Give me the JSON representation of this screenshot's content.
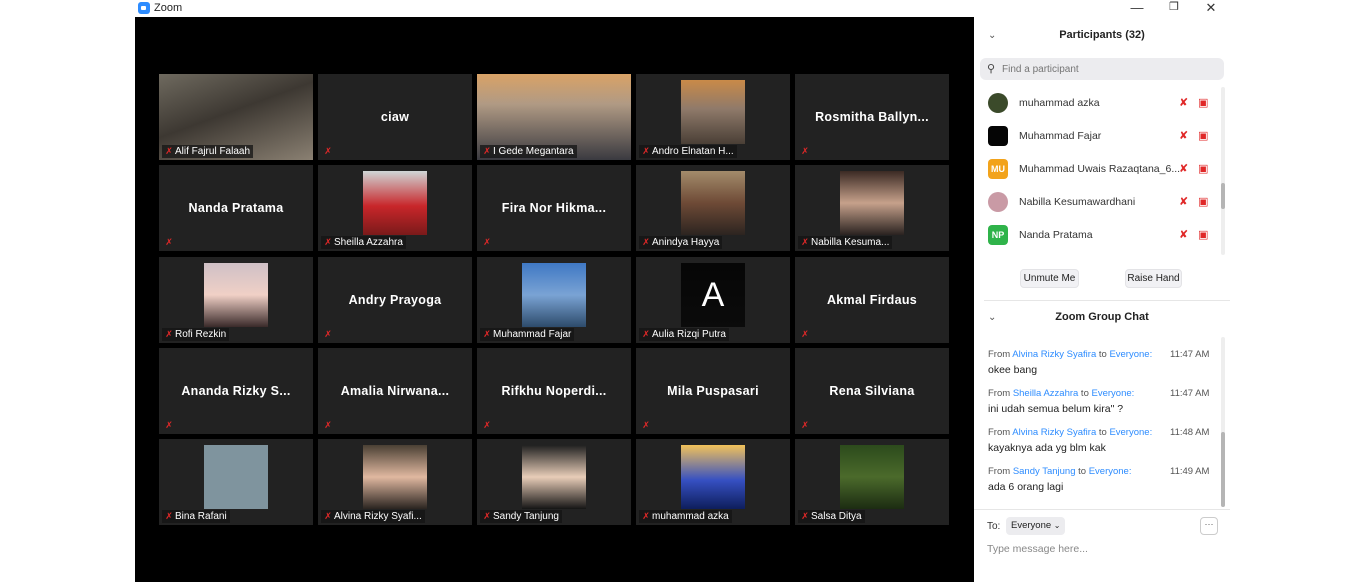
{
  "window": {
    "title": "Zoom",
    "minimize_icon": "minimize-icon",
    "restore_icon": "restore-icon",
    "close_icon": "close-icon"
  },
  "tiles": [
    {
      "name": "Alif Fajrul Falaah",
      "label": "Alif Fajrul Falaah",
      "has_video": true,
      "active": true
    },
    {
      "name": "ciaw",
      "label": "",
      "has_video": false
    },
    {
      "name": "I Gede Megantara",
      "label": "I Gede Megantara",
      "has_video": true
    },
    {
      "name": "Andro Elnatan H...",
      "label": "Andro Elnatan H...",
      "has_video": true
    },
    {
      "name": "Rosmitha  Ballyn...",
      "label": "",
      "has_video": false
    },
    {
      "name": "Nanda Pratama",
      "label": "",
      "has_video": false
    },
    {
      "name": "Sheilla Azzahra",
      "label": "Sheilla Azzahra",
      "has_video": true
    },
    {
      "name": "Fira  Nor  Hikma...",
      "label": "",
      "has_video": false
    },
    {
      "name": "Anindya Hayya",
      "label": "Anindya Hayya",
      "has_video": true
    },
    {
      "name": "Nabilla Kesuma...",
      "label": "Nabilla Kesuma...",
      "has_video": true
    },
    {
      "name": "Rofi Rezkin",
      "label": "Rofi Rezkin",
      "has_video": true
    },
    {
      "name": "Andry Prayoga",
      "label": "",
      "has_video": false
    },
    {
      "name": "Muhammad Fajar",
      "label": "Muhammad Fajar",
      "has_video": true
    },
    {
      "name": "Aulia Rizqi Putra",
      "label": "Aulia Rizqi Putra",
      "has_video": true,
      "letter": "A"
    },
    {
      "name": "Akmal Firdaus",
      "label": "",
      "has_video": false
    },
    {
      "name": "Ananda  Rizky  S...",
      "label": "",
      "has_video": false
    },
    {
      "name": "Amalia  Nirwana...",
      "label": "",
      "has_video": false
    },
    {
      "name": "Rifkhu  Noperdi...",
      "label": "",
      "has_video": false
    },
    {
      "name": "Mila Puspasari",
      "label": "",
      "has_video": false
    },
    {
      "name": "Rena Silviana",
      "label": "",
      "has_video": false
    },
    {
      "name": "Bina Rafani",
      "label": "Bina Rafani",
      "has_video": true
    },
    {
      "name": "Alvina Rizky Syafi...",
      "label": "Alvina Rizky Syafi...",
      "has_video": true
    },
    {
      "name": "Sandy Tanjung",
      "label": "Sandy Tanjung",
      "has_video": true
    },
    {
      "name": "muhammad azka",
      "label": "muhammad azka",
      "has_video": true
    },
    {
      "name": "Salsa Ditya",
      "label": "Salsa Ditya",
      "has_video": true
    }
  ],
  "participants": {
    "header": "Participants (32)",
    "search_placeholder": "Find a participant",
    "list": [
      {
        "name": "muhammad azka",
        "avatar_text": "",
        "avatar_color": "#3b4a2a"
      },
      {
        "name": "Muhammad Fajar",
        "avatar_text": "",
        "avatar_color": "#050505"
      },
      {
        "name": "Muhammad Uwais Razaqtana_6...",
        "avatar_text": "MU",
        "avatar_color": "#f2a31b"
      },
      {
        "name": "Nabilla Kesumawardhani",
        "avatar_text": "",
        "avatar_color": "#c99aa5"
      },
      {
        "name": "Nanda Pratama",
        "avatar_text": "NP",
        "avatar_color": "#2fb34a"
      }
    ],
    "unmute_label": "Unmute Me",
    "raise_hand_label": "Raise Hand"
  },
  "chat": {
    "header": "Zoom Group Chat",
    "messages": [
      {
        "from_prefix": "From",
        "sender": "Alvina Rizky Syafira",
        "to_word": "to",
        "recipient": "Everyone:",
        "time": "11:47 AM",
        "text": "okee bang"
      },
      {
        "from_prefix": "From",
        "sender": "Sheilla Azzahra",
        "to_word": "to",
        "recipient": "Everyone:",
        "time": "11:47 AM",
        "text": "ini udah semua belum kira\" ?"
      },
      {
        "from_prefix": "From",
        "sender": "Alvina Rizky Syafira",
        "to_word": "to",
        "recipient": "Everyone:",
        "time": "11:48 AM",
        "text": "kayaknya ada yg blm kak"
      },
      {
        "from_prefix": "From",
        "sender": "Sandy Tanjung",
        "to_word": "to",
        "recipient": "Everyone:",
        "time": "11:49 AM",
        "text": "ada 6 orang lagi"
      }
    ],
    "to_label": "To:",
    "to_value": "Everyone",
    "more_label": "···",
    "input_placeholder": "Type message here..."
  },
  "colors": {
    "active_speaker": "#d9ea5c",
    "muted": "#e02828",
    "link_blue": "#2d8cff"
  }
}
